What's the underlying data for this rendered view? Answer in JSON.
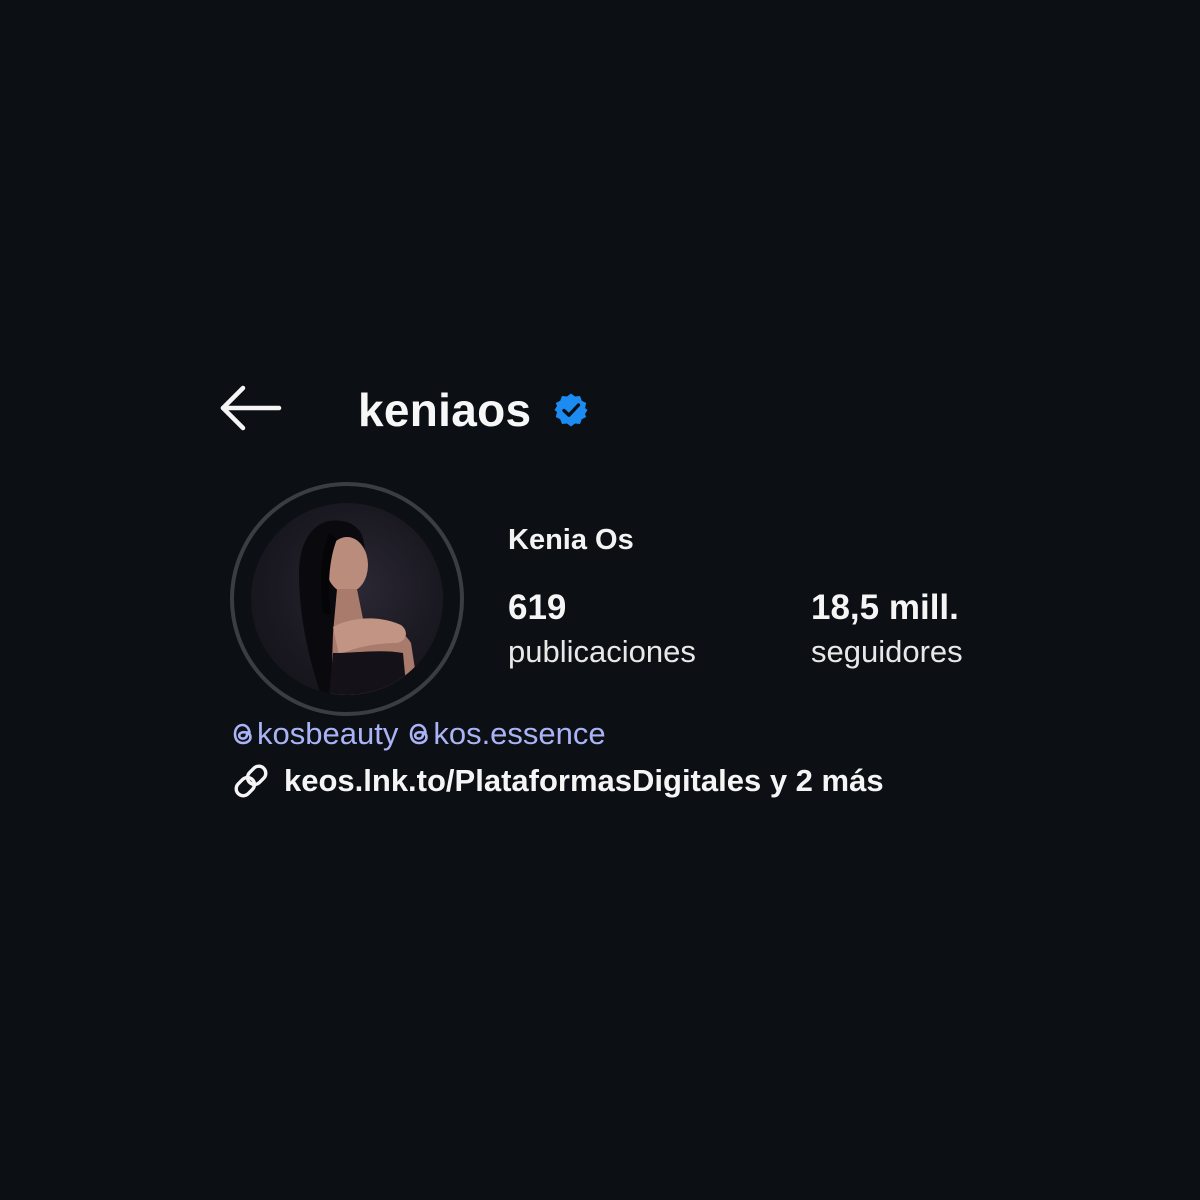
{
  "profile": {
    "username": "keniaos",
    "full_name": "Kenia Os",
    "verified": true,
    "stats": {
      "posts_count": "619",
      "posts_label": "publicaciones",
      "followers_count": "18,5 mill.",
      "followers_label": "seguidores"
    },
    "bio_mentions": [
      "kosbeauty",
      "kos.essence"
    ],
    "link": "keos.lnk.to/PlataformasDigitales y 2 más"
  },
  "icons": {
    "back": "arrow-left-icon",
    "verified": "verified-badge-icon",
    "threads": "threads-icon",
    "link": "link-icon"
  },
  "colors": {
    "background": "#0c0f14",
    "verified_blue": "#1d8cf2",
    "mention_color": "#a9b3f5",
    "text": "#f5f5f5"
  }
}
